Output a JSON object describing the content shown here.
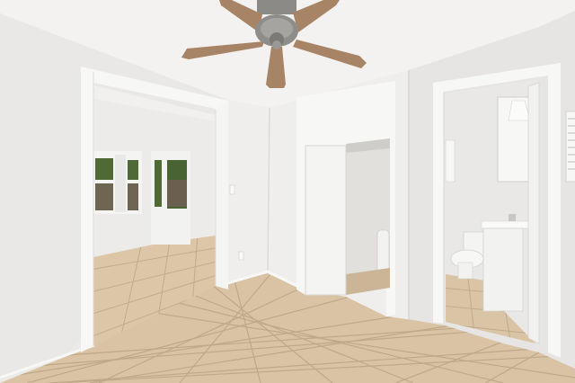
{
  "scene": {
    "kind": "photo",
    "content": "empty-room-interior"
  },
  "colors": {
    "ceiling": "#f3f2f0",
    "wall_left": "#e9e8e6",
    "wall_center": "#eeedeb",
    "wall_right": "#e4e3e1",
    "trim": "#f7f7f5",
    "floor_tile": "#d9c3a4",
    "floor_grout": "#bfa888",
    "window_green": "#4f6a35",
    "fan_blade": "#a88466",
    "fan_metal": "#8c8a86",
    "toilet": "#f4f4f2",
    "vanity": "#f2f2f0"
  }
}
